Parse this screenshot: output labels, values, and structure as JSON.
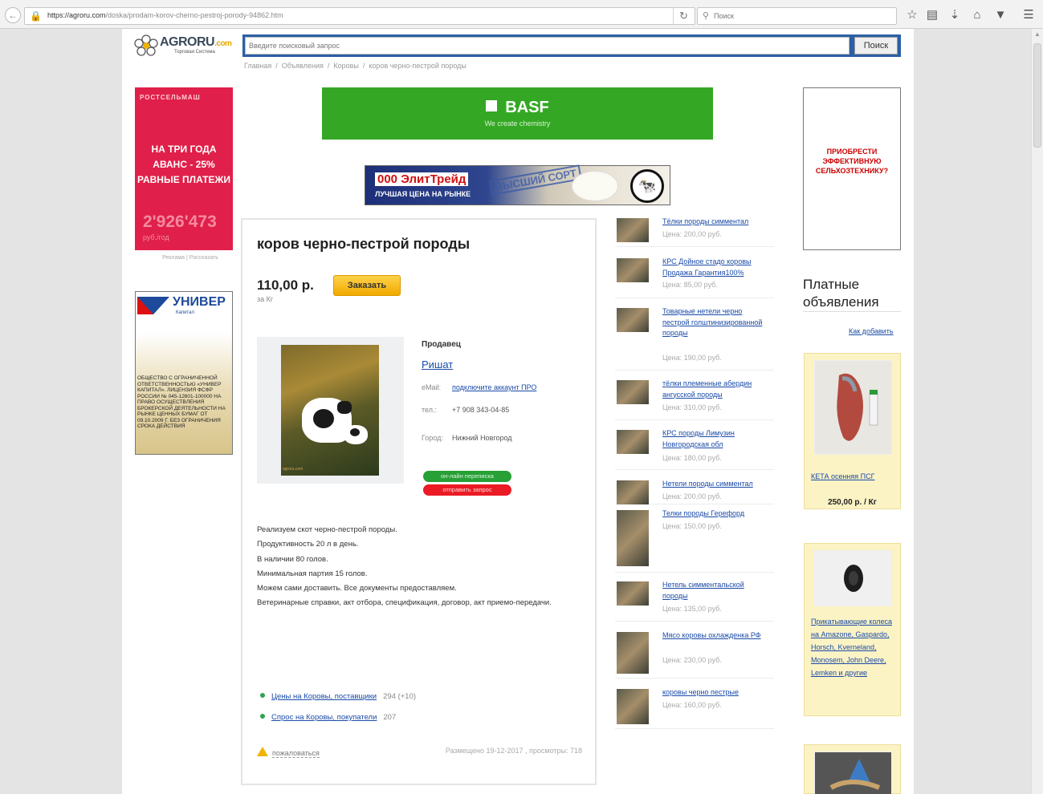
{
  "browser": {
    "url_host": "https://agroru.com",
    "url_path": "/doska/prodam-korov-cherno-pestroj-porody-94862.htm",
    "search_placeholder": "Поиск",
    "icons": [
      "back-icon",
      "lock-icon",
      "reload-icon",
      "search-icon",
      "star-icon",
      "clipboard-icon",
      "download-icon",
      "home-icon",
      "pocket-icon",
      "menu-icon"
    ]
  },
  "site": {
    "logo_text": "AGRORU",
    "logo_suffix": ".com",
    "logo_subtitle": "Торговая Система",
    "search_placeholder": "Введите поисковый запрос",
    "search_button": "Поиск"
  },
  "breadcrumb": {
    "items": [
      "Главная",
      "Объявления",
      "Коровы"
    ],
    "current": "коров черно-пестрой породы"
  },
  "ads": {
    "rost": {
      "brand": "РОСТСЕЛЬМАШ",
      "offer_line1": "НА ТРИ ГОДА",
      "offer_line2": "АВАНС - 25%",
      "offer_line3": "РАВНЫЕ ПЛАТЕЖИ",
      "price": "2'926'473",
      "unit": "руб./год"
    },
    "rost_links": "Реклама | Рассказать",
    "univer": {
      "brand": "УНИВЕР",
      "sub": "Капитал",
      "legal": "ОБЩЕСТВО С ОГРАНИЧЕННОЙ ОТВЕТСТВЕННОСТЬЮ «УНИВЕР КАПИТАЛ». ЛИЦЕНЗИЯ ФСФР РОССИИ № 045-12601-100000 НА ПРАВО ОСУЩЕСТВЛЕНИЯ БРОКЕРСКОЙ ДЕЯТЕЛЬНОСТИ НА РЫНКЕ ЦЕННЫХ БУМАГ ОТ 09.10.2009 Г. БЕЗ ОГРАНИЧЕНИЯ СРОКА ДЕЙСТВИЯ"
    },
    "basf": {
      "logo": "BASF",
      "tagline": "We create chemistry"
    },
    "elit": {
      "name": "000 ЭлитТрейд",
      "slogan": "ЛУЧШАЯ ЦЕНА НА РЫНКЕ",
      "stamp": "ВЫСШИЙ СОРТ"
    },
    "agri": {
      "line1": "ПРИОБРЕСТИ",
      "line2": "ЭФФЕКТИВНУЮ",
      "line3": "СЕЛЬХОЗТЕХНИКУ?"
    }
  },
  "listing": {
    "title": "коров черно-пестрой породы",
    "price": "110,00 р.",
    "price_unit": "за Кг",
    "order_button": "Заказать",
    "seller_heading": "Продавец",
    "seller_name": "Ришат",
    "email_label": "eMail:",
    "email_value": "подключите аккаунт ПРО",
    "phone_label": "тел.:",
    "phone_value": "+7 908 343-04-85",
    "city_label": "Город:",
    "city_value": "Нижний Новгород",
    "online_button": "он-лайн переписка",
    "request_button": "отправить запрос",
    "description": [
      "Реализуем скот черно-пестрой породы.",
      "Продуктивность 20 л в день.",
      "В наличии 80 голов.",
      "Минимальная партия 15 голов.",
      "Можем сами доставить. Все документы предоставляем.",
      "Ветеринарные справки, акт отбора, спецификация, договор, акт приемо-передачи."
    ],
    "stats": [
      {
        "label": "Цены на Коровы, поставщики",
        "count": "294 (+10)"
      },
      {
        "label": "Спрос на Коровы, покупатели",
        "count": "207"
      }
    ],
    "complain": "пожаловаться",
    "posted": "Размещено 19-12-2017 , просмотры: 718"
  },
  "similar": [
    {
      "title": "Тёлки породы симментал",
      "price": "Цена: 200,00 руб."
    },
    {
      "title": "КРС Дойное стадо коровы Продажа Гарантия100%",
      "price": "Цена: 85,00 руб."
    },
    {
      "title": "Товарные нетели черно пестрой голштинизированной породы",
      "price": "Цена: 190,00 руб."
    },
    {
      "title": "тёлки племенные абердин ангусской породы",
      "price": "Цена: 310,00 руб."
    },
    {
      "title": "КРС породы Лимузин Новгородская обл",
      "price": "Цена: 180,00 руб."
    },
    {
      "title": "Нетели породы симментал",
      "price": "Цена: 200,00 руб."
    },
    {
      "title": "Телки породы Герефорд",
      "price": "Цена: 150,00 руб."
    },
    {
      "title": "Нетель симментальской породы",
      "price": "Цена: 135,00 руб."
    },
    {
      "title": "Мясо коровы охлажденка РФ",
      "price": "Цена: 230,00 руб."
    },
    {
      "title": "коровы черно пестрые",
      "price": "Цена: 160,00 руб."
    }
  ],
  "paid": {
    "title": "Платные объявления",
    "how_to_add": "Как добавить",
    "items": [
      {
        "name": "КЕТА осенняя ПСГ",
        "price": "250,00 р. / Кг"
      },
      {
        "name": "Прикатывающие колеса на Amazone, Gaspardo, Horsch, Kverneland, Monosem, John Deere, Lemken и другие",
        "price": ""
      }
    ]
  }
}
